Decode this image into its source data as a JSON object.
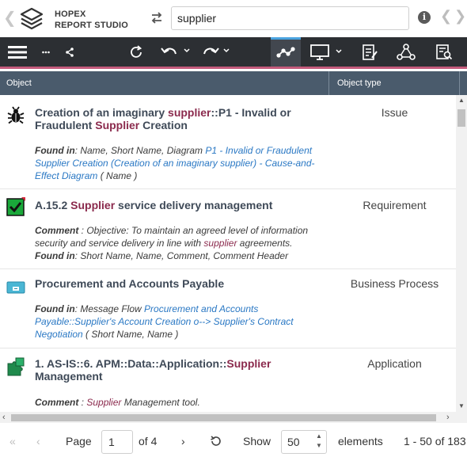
{
  "header": {
    "brand_line1": "HOPEX",
    "brand_line2": "REPORT STUDIO",
    "search_value": "supplier",
    "info_glyph": "i"
  },
  "toolbar": {
    "icons": [
      "menu-icon",
      "more-icon",
      "share-icon",
      "refresh-icon",
      "undo-icon",
      "redo-icon",
      "graph-view-icon",
      "display-icon",
      "report-icon",
      "network-icon",
      "document-search-icon"
    ],
    "active": "graph-view-icon",
    "accent_color": "#c45a7b"
  },
  "columns": {
    "object": "Object",
    "object_type": "Object type"
  },
  "rows": [
    {
      "icon": "bug-icon",
      "title_parts": [
        "Creation of an imaginary ",
        "supplier",
        "::P1 - Invalid or Fraudulent ",
        "Supplier",
        " Creation"
      ],
      "type": "Issue",
      "found_label": "Found in",
      "found_fields": ": Name, Short Name, Diagram ",
      "found_link": "P1 - Invalid or Fraudulent Supplier Creation (Creation of an imaginary supplier) - Cause-and-Effect Diagram",
      "found_tail": " ( Name )"
    },
    {
      "icon": "requirement-check-icon",
      "title_parts": [
        "A.15.2 ",
        "Supplier",
        " service delivery management"
      ],
      "type": "Requirement",
      "comment_label": "Comment",
      "comment_text": " : Objective: To maintain an agreed level of information security and service delivery in line with ",
      "comment_hl": "supplier",
      "comment_tail": " agreements.",
      "found_label": "Found in",
      "found_fields": ": Short Name, Name, Comment, Comment Header"
    },
    {
      "icon": "business-process-icon",
      "title_parts": [
        "Procurement and Accounts Payable"
      ],
      "type": "Business Process",
      "found_label": "Found in",
      "found_fields": ": Message Flow ",
      "found_link": "Procurement and Accounts Payable::Supplier's Account Creation o--> Supplier's Contract Negotiation",
      "found_tail": " ( Short Name, Name )"
    },
    {
      "icon": "application-puzzle-icon",
      "title_parts": [
        "1. AS-IS::6. APM::Data::Application::",
        "Supplier",
        " Management"
      ],
      "type": "Application",
      "comment_label": "Comment",
      "comment_pre": " : ",
      "comment_hl": "Supplier",
      "comment_tail": " Management tool."
    }
  ],
  "pager": {
    "page_label": "Page",
    "page_value": "1",
    "of_label": "of 4",
    "show_label": "Show",
    "page_size": "50",
    "elements_label": "elements",
    "range": "1 - 50 of 183"
  }
}
